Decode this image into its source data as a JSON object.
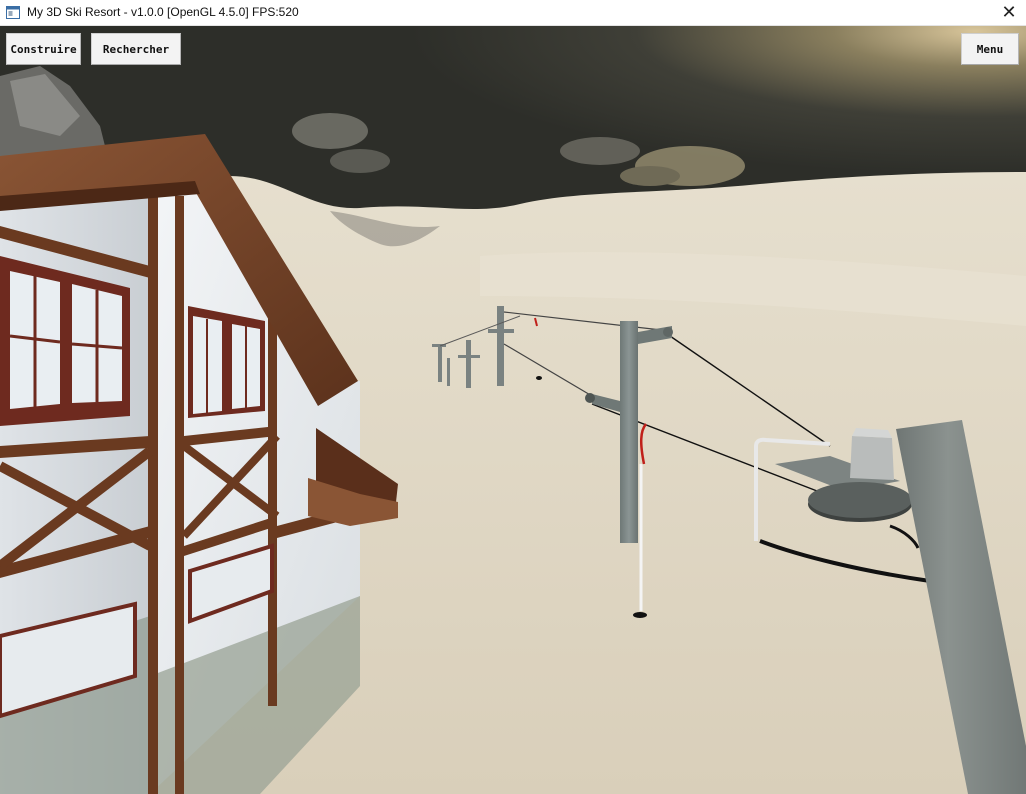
{
  "window": {
    "title": "My 3D Ski Resort - v1.0.0 [OpenGL 4.5.0] FPS:520",
    "close_glyph": "✕",
    "app_icon": "window-app-icon"
  },
  "hud": {
    "build_label": "Construire",
    "search_label": "Rechercher",
    "menu_label": "Menu"
  },
  "scene": {
    "sky_color": "#30312b",
    "snow_color": "#e2dac8",
    "chalet_wall_color": "#eef1f3",
    "timber_color": "#6a3a20",
    "pylon_color": "#7f8a89"
  }
}
